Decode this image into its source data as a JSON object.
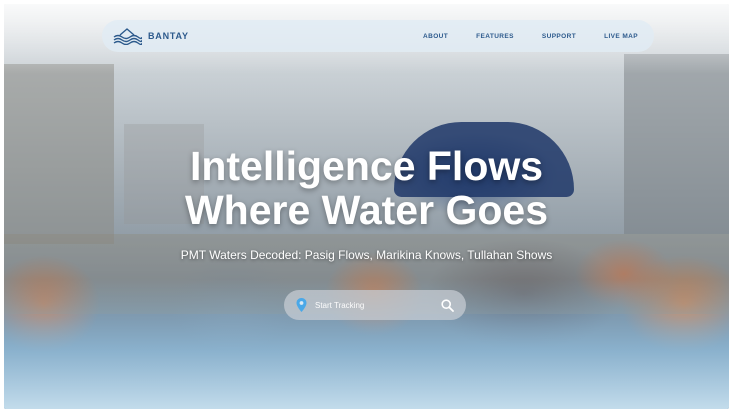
{
  "brand": {
    "name": "BANTAY",
    "icon": "waves-logo-icon",
    "color": "#2c5a8c"
  },
  "nav": {
    "links": [
      {
        "label": "ABOUT"
      },
      {
        "label": "FEATURES"
      },
      {
        "label": "SUPPORT"
      },
      {
        "label": "LIVE MAP"
      }
    ]
  },
  "hero": {
    "title_line1": "Intelligence Flows",
    "title_line2": "Where Water Goes",
    "subtitle": "PMT Waters Decoded: Pasig Flows, Marikina Knows, Tullahan Shows"
  },
  "search": {
    "placeholder": "Start Tracking",
    "value": "",
    "leading_icon": "map-pin-icon",
    "trailing_icon": "search-icon",
    "pin_color": "#4aa8e8"
  }
}
